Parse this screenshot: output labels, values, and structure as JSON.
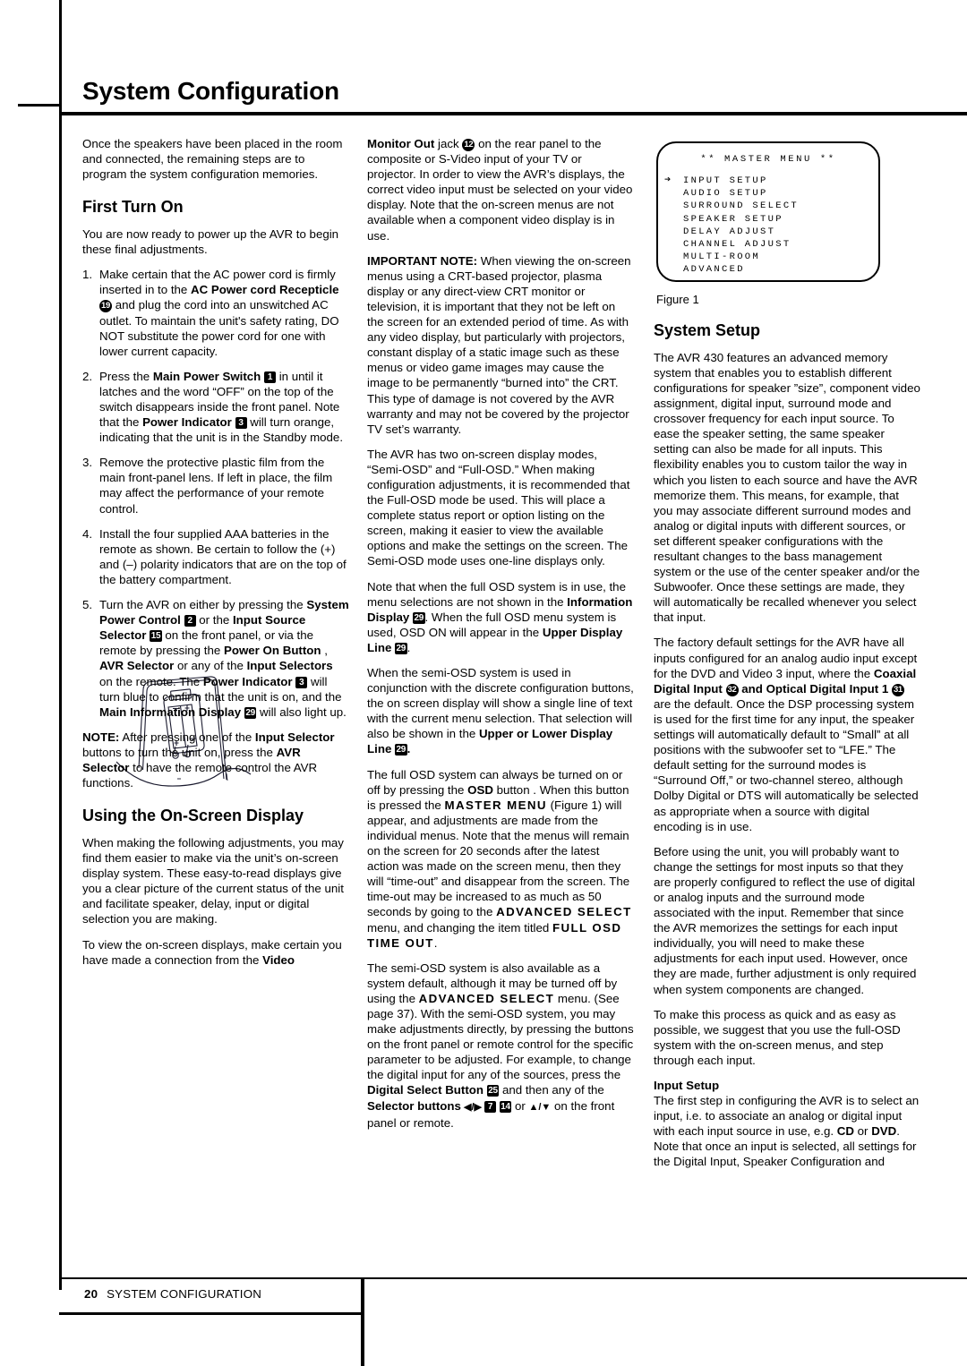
{
  "page": {
    "title": "System Configuration",
    "footer_page_number": "20",
    "footer_label": "SYSTEM CONFIGURATION"
  },
  "figure": {
    "caption": "Figure 1",
    "osd_title": "**  MASTER  MENU  **",
    "osd_items": [
      "INPUT SETUP",
      "AUDIO SETUP",
      "SURROUND SELECT",
      "SPEAKER SETUP",
      "DELAY ADJUST",
      "CHANNEL ADJUST",
      "MULTI-ROOM",
      "ADVANCED"
    ],
    "osd_selected_index": 0,
    "osd_cursor_glyph": "➔"
  },
  "column1": {
    "intro": "Once the speakers have been placed in the room and connected, the remaining steps are to program the system configuration memories.",
    "heading_first_turn_on": "First Turn On",
    "first_turn_on_intro": "You are now ready to power up the AVR to begin these final adjustments.",
    "steps": [
      {
        "number": "1.",
        "parts": [
          {
            "t": "Make certain that the AC power cord is firmly inserted in to the ",
            "style": "normal"
          },
          {
            "t": "AC Power cord Recepticle",
            "style": "bold"
          },
          {
            "t": " ",
            "style": "normal"
          },
          {
            "t": "19",
            "style": "badge-circle"
          },
          {
            "t": " and plug the cord into an unswitched AC outlet. To maintain the unit's safety rating, DO NOT substitute the power cord for one with lower current capacity.",
            "style": "normal"
          }
        ]
      },
      {
        "number": "2.",
        "parts": [
          {
            "t": "Press the ",
            "style": "normal"
          },
          {
            "t": "Main Power Switch",
            "style": "bold"
          },
          {
            "t": " ",
            "style": "normal"
          },
          {
            "t": "1",
            "style": "badge"
          },
          {
            "t": " in until it latches and the word “OFF” on the top of the switch disappears inside the front panel. Note that the ",
            "style": "normal"
          },
          {
            "t": "Power Indicator",
            "style": "bold"
          },
          {
            "t": " ",
            "style": "normal"
          },
          {
            "t": "3",
            "style": "badge"
          },
          {
            "t": "  will turn orange, indicating that the unit is in the Standby mode.",
            "style": "normal"
          }
        ]
      },
      {
        "number": "3.",
        "parts": [
          {
            "t": "Remove the protective plastic film from the main front-panel lens. If left in place, the film may affect the performance of your remote control.",
            "style": "normal"
          }
        ]
      },
      {
        "number": "4.",
        "parts": [
          {
            "t": "Install the four supplied AAA batteries in the remote as shown. Be certain to follow the (+) and (–) polarity indicators that are on the top of the battery compartment.",
            "style": "normal"
          }
        ]
      },
      {
        "number": "5.",
        "parts": [
          {
            "t": "Turn the AVR on either by pressing the ",
            "style": "normal"
          },
          {
            "t": "System Power Control",
            "style": "bold"
          },
          {
            "t": " ",
            "style": "normal"
          },
          {
            "t": "2",
            "style": "badge"
          },
          {
            "t": " or the ",
            "style": "normal"
          },
          {
            "t": "Input Source Selector",
            "style": "bold"
          },
          {
            "t": " ",
            "style": "normal"
          },
          {
            "t": "15",
            "style": "badge"
          },
          {
            "t": " on the front panel, or via the remote by pressing the ",
            "style": "normal"
          },
          {
            "t": "Power On Button",
            "style": "bold"
          },
          {
            "t": "         , ",
            "style": "normal"
          },
          {
            "t": "AVR Selector",
            "style": "bold"
          },
          {
            "t": "        or any of the ",
            "style": "normal"
          },
          {
            "t": "Input Selectors",
            "style": "bold"
          },
          {
            "t": "           on the remote. The ",
            "style": "normal"
          },
          {
            "t": "Power Indicator",
            "style": "bold"
          },
          {
            "t": " ",
            "style": "normal"
          },
          {
            "t": "3",
            "style": "badge"
          },
          {
            "t": " will turn blue to confirm that the unit is on, and the ",
            "style": "normal"
          },
          {
            "t": "Main Information Display",
            "style": "bold"
          },
          {
            "t": " ",
            "style": "normal"
          },
          {
            "t": "29",
            "style": "badge"
          },
          {
            "t": " will also light up.",
            "style": "normal"
          }
        ]
      }
    ],
    "note": [
      {
        "t": "NOTE:",
        "style": "bold"
      },
      {
        "t": " After pressing one of the ",
        "style": "normal"
      },
      {
        "t": "Input Selector",
        "style": "bold"
      },
      {
        "t": " buttons",
        "style": "normal"
      },
      {
        "t": "        to turn the unit on, press the ",
        "style": "normal"
      },
      {
        "t": "AVR Selector",
        "style": "bold"
      },
      {
        "t": "        to have the remote control the AVR functions.",
        "style": "normal"
      }
    ],
    "heading_osd": "Using the On-Screen Display",
    "osd_para_1": "When making the following adjustments, you may find them easier to make via the unit’s on-screen display system. These easy-to-read displays give you a clear picture of the current status of the unit and facilitate speaker, delay, input or digital selection you are making.",
    "osd_para_2_parts": [
      {
        "t": "To view the on-screen displays, make certain you have made a connection from the ",
        "style": "normal"
      },
      {
        "t": "Video",
        "style": "bold"
      }
    ]
  },
  "column2": {
    "para_monitor_out": [
      {
        "t": "Monitor Out",
        "style": "bold"
      },
      {
        "t": " jack ",
        "style": "normal"
      },
      {
        "t": "12",
        "style": "badge-circle"
      },
      {
        "t": " on the rear panel to the composite or S-Video input of your TV or projector. In order to view the AVR’s displays, the correct video input must be selected on your video display. Note that the on-screen menus are not available when a component video display is in use.",
        "style": "normal"
      }
    ],
    "para_important_note": [
      {
        "t": "IMPORTANT NOTE:",
        "style": "bold"
      },
      {
        "t": " When viewing the on-screen menus using a CRT-based projector, plasma display or any direct-view CRT monitor or television, it is important that they not be left on the screen for an extended period of time. As with any video display, but particularly with projectors, constant display of a static image such as these menus or video game images may cause the image to be permanently “burned into” the CRT. This type of damage is not covered by the AVR warranty and may not be covered by the projector TV set’s warranty.",
        "style": "normal"
      }
    ],
    "para_two_modes": "The AVR has two on-screen display modes, “Semi-OSD” and “Full-OSD.” When making configuration adjustments, it is recommended that the Full-OSD mode be used. This will place a complete status report or option listing on the screen, making it easier to view the available options and make the settings on the screen. The Semi-OSD mode uses one-line displays only.",
    "para_full_osd": [
      {
        "t": "Note that when the full OSD system is in use, the menu selections are not shown in the ",
        "style": "normal"
      },
      {
        "t": "Information Display",
        "style": "bold"
      },
      {
        "t": " ",
        "style": "normal"
      },
      {
        "t": "29",
        "style": "badge"
      },
      {
        "t": ". When the full OSD menu system is used, OSD ON will appear in the ",
        "style": "normal"
      },
      {
        "t": "Upper Display Line",
        "style": "bold"
      },
      {
        "t": " ",
        "style": "normal"
      },
      {
        "t": "29",
        "style": "badge"
      },
      {
        "t": ".",
        "style": "normal"
      }
    ],
    "para_semi_osd": [
      {
        "t": "When the semi-OSD system is used in conjunction with the discrete configuration buttons, the on screen display will show a single line of text with the current menu selection. That selection will also be shown in the ",
        "style": "normal"
      },
      {
        "t": "Upper or Lower Display Line",
        "style": "bold"
      },
      {
        "t": " ",
        "style": "normal"
      },
      {
        "t": "29",
        "style": "badge"
      },
      {
        "t": ".",
        "style": "bold"
      }
    ],
    "para_osd_button": [
      {
        "t": "The full OSD system can always be turned on or off by pressing the ",
        "style": "normal"
      },
      {
        "t": "OSD",
        "style": "bold"
      },
      {
        "t": " button",
        "style": "normal"
      },
      {
        "t": "        . When this button is pressed the ",
        "style": "normal"
      },
      {
        "t": "MASTER MENU",
        "style": "osd"
      },
      {
        "t": " (Figure 1) will appear, and adjustments are made from the individual menus. Note that the menus will remain on the screen for 20 seconds after the latest action was made on the screen menu, then they will “time-out” and disappear from the screen. The time-out may be increased to as much as 50 seconds by going to the ",
        "style": "normal"
      },
      {
        "t": "ADVANCED SELECT",
        "style": "osd"
      },
      {
        "t": " menu, and changing the item titled ",
        "style": "normal"
      },
      {
        "t": "FULL OSD TIME OUT",
        "style": "osd"
      },
      {
        "t": ".",
        "style": "normal"
      }
    ],
    "para_semi_default": [
      {
        "t": "The semi-OSD system is also available as a system default, although it may be turned off by using the ",
        "style": "normal"
      },
      {
        "t": "ADVANCED SELECT",
        "style": "osd"
      },
      {
        "t": " menu. (See page 37). With the semi-OSD system, you may make adjustments directly, by pressing the buttons on the front panel or remote control for the specific parameter to be adjusted. For example, to change the digital input for any of the sources, press the ",
        "style": "normal"
      },
      {
        "t": "Digital Select Button",
        "style": "bold"
      },
      {
        "t": " ",
        "style": "normal"
      },
      {
        "t": "25",
        "style": "badge"
      },
      {
        "t": "       and then any of the ",
        "style": "normal"
      },
      {
        "t": "Selector buttons",
        "style": "bold"
      },
      {
        "t": " ◀/▶ ",
        "style": "bold-arrows"
      },
      {
        "t": "7",
        "style": "badge"
      },
      {
        "t": " ",
        "style": "normal"
      },
      {
        "t": "14",
        "style": "badge"
      },
      {
        "t": " or ",
        "style": "normal"
      },
      {
        "t": "▲/▼",
        "style": "bold-arrows"
      },
      {
        "t": " on the front panel or remote.",
        "style": "normal"
      }
    ]
  },
  "column3": {
    "heading_system_setup": "System Setup",
    "para_1": "The AVR 430 features an advanced memory system that enables you to establish different configurations for speaker ”size”, component video assignment, digital input, surround mode and crossover frequency for each input source. To ease the speaker setting, the same speaker setting can also be made for all inputs. This flexibility enables you to custom tailor the way in which you listen to each source and have the AVR memorize them. This means, for example, that you may associate different surround modes and analog or digital inputs with different sources, or set different speaker configurations with the resultant changes to the bass management system or the use of the center speaker and/or the Subwoofer. Once these settings are made, they will automatically be recalled whenever you select that input.",
    "para_2": [
      {
        "t": "The factory default settings for the AVR have all inputs configured for an analog audio input except for the DVD and Video 3 input, where the ",
        "style": "normal"
      },
      {
        "t": "Coaxial Digital Input",
        "style": "bold"
      },
      {
        "t": " ",
        "style": "normal"
      },
      {
        "t": "32",
        "style": "badge-circle"
      },
      {
        "t": " and ",
        "style": "bold"
      },
      {
        "t": "Optical Digital Input 1",
        "style": "bold"
      },
      {
        "t": " ",
        "style": "normal"
      },
      {
        "t": "31",
        "style": "badge-circle"
      },
      {
        "t": " are the default. Once the DSP processing system is used for the first time for any input, the speaker settings will automatically default to “Small” at all positions with the subwoofer set to “LFE.” The default setting for the surround modes is “Surround Off,” or two-channel stereo, although Dolby Digital or DTS will automatically be selected as appropriate when a source with digital encoding is in use.",
        "style": "normal"
      }
    ],
    "para_3": "Before using the unit, you will probably want to change the settings for most inputs so that they are properly configured to reflect the use of digital or analog inputs and the surround mode associated with the input. Remember that since the AVR memorizes the settings for each input individually, you will need to make these adjustments for each input used. However, once they are made, further adjustment is only required when system components are changed.",
    "para_4": "To make this process as quick and as easy as possible, we suggest that you use the full-OSD system with the on-screen menus, and step through each input.",
    "heading_input_setup": "Input Setup",
    "para_5": [
      {
        "t": "The first step in configuring the AVR is to select an input, i.e. to associate an analog or digital input with each input source in use, e.g. ",
        "style": "normal"
      },
      {
        "t": "CD",
        "style": "bold"
      },
      {
        "t": " or ",
        "style": "normal"
      },
      {
        "t": "DVD",
        "style": "bold"
      },
      {
        "t": ". Note that once an input is selected, all settings for the Digital Input, Speaker Configuration and",
        "style": "normal"
      }
    ]
  }
}
